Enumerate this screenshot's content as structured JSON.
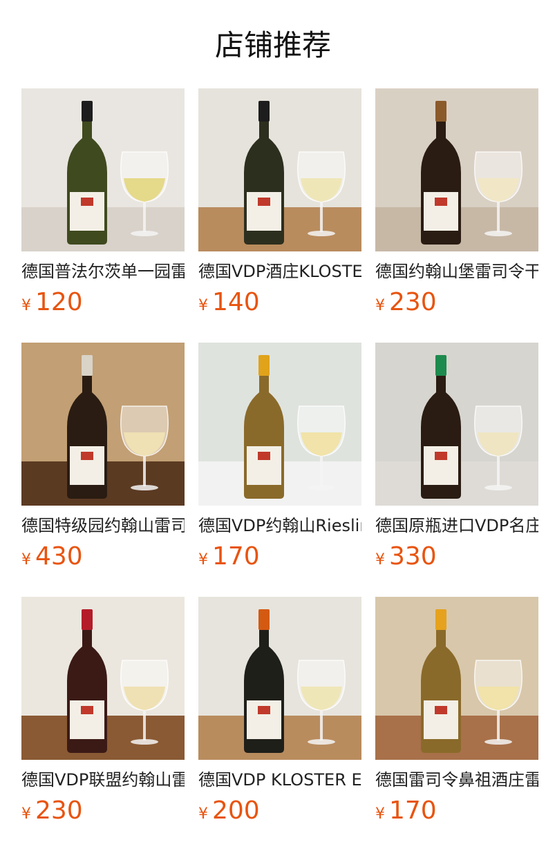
{
  "page": {
    "title": "店铺推荐"
  },
  "products": [
    {
      "name": "德国普法尔茨单一园雷司令",
      "currency": "¥",
      "price": "120",
      "bg": "#e9e6e1",
      "floor": "#d8d2ca",
      "bottle": "#3f4a1f",
      "wine": "#e5d98a",
      "capsule": "#1d1d1d"
    },
    {
      "name": "德国VDP酒庄KLOSTER EBERBACH",
      "currency": "¥",
      "price": "140",
      "bg": "#e6e3dc",
      "floor": "#b98c5e",
      "bottle": "#2d2f1e",
      "wine": "#efe6b8",
      "capsule": "#1d1d1d"
    },
    {
      "name": "德国约翰山堡雷司令干白",
      "currency": "¥",
      "price": "230",
      "bg": "#d9d0c4",
      "floor": "#c7b8a6",
      "bottle": "#2a1c12",
      "wine": "#f1e7c6",
      "capsule": "#8b5a2b"
    },
    {
      "name": "德国特级园约翰山雷司令",
      "currency": "¥",
      "price": "430",
      "bg": "#c29f74",
      "floor": "#5b3a22",
      "bottle": "#2a1c12",
      "wine": "#efe1b3",
      "capsule": "#d9d3c8"
    },
    {
      "name": "德国VDP约翰山Riesling",
      "currency": "¥",
      "price": "170",
      "bg": "#dfe3de",
      "floor": "#f2f2f2",
      "bottle": "#8a6a2a",
      "wine": "#f1e3a9",
      "capsule": "#e0a31a"
    },
    {
      "name": "德国原瓶进口VDP名庄雷司令",
      "currency": "¥",
      "price": "330",
      "bg": "#d7d5cf",
      "floor": "#dedbd6",
      "bottle": "#2a1c12",
      "wine": "#efe5c2",
      "capsule": "#1d8a4e"
    },
    {
      "name": "德国VDP联盟约翰山雷司令",
      "currency": "¥",
      "price": "230",
      "bg": "#ebe7de",
      "floor": "#8a5a34",
      "bottle": "#3b1a16",
      "wine": "#efe1b3",
      "capsule": "#b51c2a"
    },
    {
      "name": "德国VDP KLOSTER EBERBACH",
      "currency": "¥",
      "price": "200",
      "bg": "#e7e4dd",
      "floor": "#b98c5e",
      "bottle": "#1f1f1a",
      "wine": "#efe6b8",
      "capsule": "#d45a12"
    },
    {
      "name": "德国雷司令鼻祖酒庄雷司令",
      "currency": "¥",
      "price": "170",
      "bg": "#d8c7aa",
      "floor": "#a8714a",
      "bottle": "#8a6a2a",
      "wine": "#f1e3a9",
      "capsule": "#e6a21d"
    }
  ]
}
